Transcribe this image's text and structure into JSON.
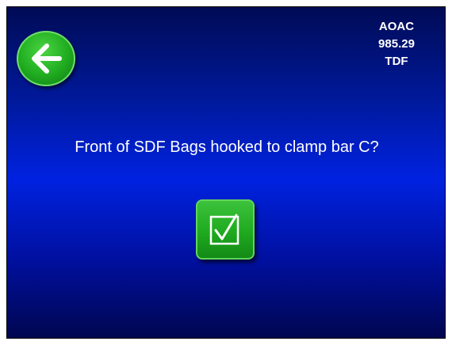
{
  "header": {
    "back_icon": "arrow-left-icon",
    "method_lines": [
      "AOAC",
      "985.29",
      "TDF"
    ]
  },
  "main": {
    "prompt": "Front of SDF Bags hooked to clamp bar C?",
    "confirm_icon": "checkbox-checked-icon"
  },
  "colors": {
    "background_center": "#0022e0",
    "background_edge": "#000650",
    "button_green": "#1faa1f",
    "text": "#ffffff"
  }
}
